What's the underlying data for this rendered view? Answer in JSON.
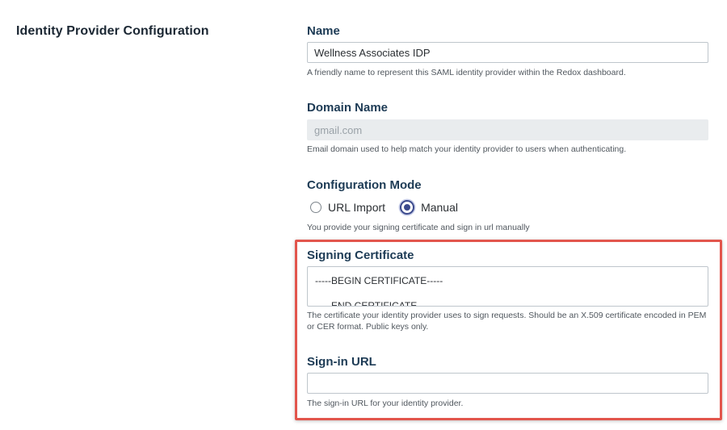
{
  "section": {
    "title": "Identity Provider Configuration"
  },
  "name_field": {
    "label": "Name",
    "value": "Wellness Associates IDP",
    "help": "A friendly name to represent this SAML identity provider within the Redox dashboard."
  },
  "domain_field": {
    "label": "Domain Name",
    "value": "gmail.com",
    "help": "Email domain used to help match your identity provider to users when authenticating."
  },
  "config_mode": {
    "label": "Configuration Mode",
    "options": [
      {
        "label": "URL Import",
        "selected": false
      },
      {
        "label": "Manual",
        "selected": true
      }
    ],
    "help": "You provide your signing certificate and sign in url manually"
  },
  "signing_certificate": {
    "label": "Signing Certificate",
    "lines": [
      "-----BEGIN CERTIFICATE-----",
      "-----END CERTIFICATE-----"
    ],
    "help": "The certificate your identity provider uses to sign requests. Should be an X.509 certificate encoded in PEM or CER format. Public keys only."
  },
  "sign_in_url": {
    "label": "Sign-in URL",
    "value": "",
    "help": "The sign-in URL for your identity provider."
  },
  "colors": {
    "heading": "#1d3b55",
    "highlight": "#e2554c",
    "radio_accent": "#3b4a8c"
  }
}
